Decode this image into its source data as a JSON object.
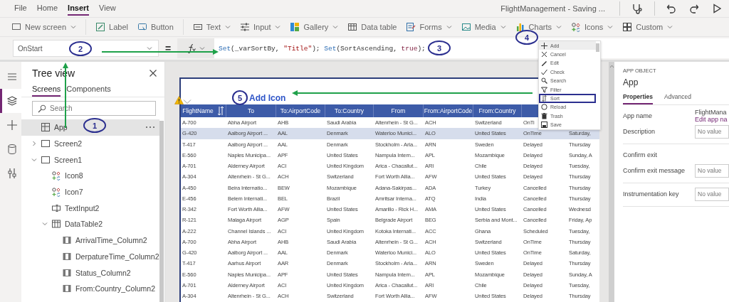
{
  "menu_tabs": [
    {
      "label": "File",
      "selected": false
    },
    {
      "label": "Home",
      "selected": false
    },
    {
      "label": "Insert",
      "selected": true
    },
    {
      "label": "View",
      "selected": false
    }
  ],
  "document_title": "FlightManagement - Saving ...",
  "toolbar": [
    {
      "label": "New screen",
      "dropdown": true
    },
    {
      "label": "Label",
      "dropdown": false
    },
    {
      "label": "Button",
      "dropdown": false
    },
    {
      "label": "Text",
      "dropdown": true
    },
    {
      "label": "Input",
      "dropdown": true
    },
    {
      "label": "Gallery",
      "dropdown": true
    },
    {
      "label": "Data table",
      "dropdown": false
    },
    {
      "label": "Forms",
      "dropdown": true
    },
    {
      "label": "Media",
      "dropdown": true
    },
    {
      "label": "Charts",
      "dropdown": true
    },
    {
      "label": "Icons",
      "dropdown": true
    },
    {
      "label": "Custom",
      "dropdown": true
    }
  ],
  "formula_bar": {
    "property": "OnStart",
    "equals": "=",
    "formula": [
      {
        "text": "Set",
        "kind": "function"
      },
      {
        "text": "(_varSortBy, ",
        "kind": "plain"
      },
      {
        "text": "\"Title\"",
        "kind": "string"
      },
      {
        "text": "); ",
        "kind": "plain"
      },
      {
        "text": "Set",
        "kind": "function"
      },
      {
        "text": "(SortAscending, ",
        "kind": "plain"
      },
      {
        "text": "true",
        "kind": "keyword"
      },
      {
        "text": ");",
        "kind": "plain"
      }
    ]
  },
  "rail": [
    {
      "selected": false
    },
    {
      "selected": true
    },
    {
      "selected": false
    },
    {
      "selected": false
    },
    {
      "selected": false
    }
  ],
  "tree_view": {
    "title": "Tree view",
    "tabs": [
      {
        "label": "Screens",
        "selected": true
      },
      {
        "label": "Components",
        "selected": false
      }
    ],
    "search": {
      "placeholder": "Search"
    },
    "items": [
      {
        "label": "App",
        "kind": "app",
        "selected": true
      },
      {
        "label": "Screen2",
        "kind": "screen",
        "selected": false,
        "expanded": false
      },
      {
        "label": "Screen1",
        "kind": "screen",
        "selected": false,
        "expanded": true,
        "children": [
          {
            "label": "Icon8",
            "kind": "icon",
            "selected": false
          },
          {
            "label": "Icon7",
            "kind": "icon",
            "selected": false
          },
          {
            "label": "TextInput2",
            "kind": "text_input",
            "selected": false
          },
          {
            "label": "DataTable2",
            "kind": "data_table",
            "selected": false,
            "expanded": true,
            "children": [
              {
                "label": "ArrivalTime_Column2",
                "kind": "column",
                "selected": false
              },
              {
                "label": "DerpatureTime_Column2",
                "kind": "column",
                "selected": false
              },
              {
                "label": "Status_Column2",
                "kind": "column",
                "selected": false
              },
              {
                "label": "From:Country_Column2",
                "kind": "column",
                "selected": false
              }
            ]
          }
        ]
      }
    ]
  },
  "table": {
    "columns": [
      {
        "label": "FlightName",
        "sort_icon": true
      },
      {
        "label": "To",
        "sort_icon": false
      },
      {
        "label": "To:AirportCode",
        "sort_icon": false
      },
      {
        "label": "To:Country",
        "sort_icon": false
      },
      {
        "label": "From",
        "sort_icon": false
      },
      {
        "label": "From:AirportCode",
        "sort_icon": false
      },
      {
        "label": "From:Country",
        "sort_icon": false
      }
    ],
    "rows": [
      {
        "selected": false,
        "cells": [
          "A-700",
          "Abha Airport",
          "AHB",
          "Saudi Arabia",
          "Altenrhein - St G...",
          "ACH",
          "Switzerland",
          "OnTi"
        ]
      },
      {
        "selected": true,
        "cells": [
          "G-420",
          "Aalborg Airport ...",
          "AAL",
          "Denmark",
          "Waterloo Munici...",
          "ALO",
          "United States",
          "OnTime",
          "Saturday,"
        ]
      },
      {
        "selected": false,
        "cells": [
          "T-417",
          "Aalborg Airport ...",
          "AAL",
          "Denmark",
          "Stockholm - Arla...",
          "ARN",
          "Sweden",
          "Delayed",
          "Thursday"
        ]
      },
      {
        "selected": false,
        "cells": [
          "E-560",
          "Naples Municipa...",
          "APF",
          "United States",
          "Nampula Intern...",
          "APL",
          "Mozambique",
          "Delayed",
          "Sunday, A"
        ]
      },
      {
        "selected": false,
        "cells": [
          "A-701",
          "Alderney Airport",
          "ACI",
          "United Kingdom",
          "Arica - Chacallut...",
          "ARI",
          "Chile",
          "Delayed",
          "Tuesday,"
        ]
      },
      {
        "selected": false,
        "cells": [
          "A-304",
          "Altenrhein - St G...",
          "ACH",
          "Switzerland",
          "Fort Worth Allia...",
          "AFW",
          "United States",
          "Delayed",
          "Thursday"
        ]
      },
      {
        "selected": false,
        "cells": [
          "A-450",
          "Beira Internatio...",
          "BEW",
          "Mozambique",
          "Adana-Sakirpas...",
          "ADA",
          "Turkey",
          "Cancelled",
          "Thursday"
        ]
      },
      {
        "selected": false,
        "cells": [
          "E-456",
          "Belem Internati...",
          "BEL",
          "Brazil",
          "Amritsar Interna...",
          "ATQ",
          "India",
          "Cancelled",
          "Thursday"
        ]
      },
      {
        "selected": false,
        "cells": [
          "R-342",
          "Fort Worth Allia...",
          "AFW",
          "United States",
          "Amarillo - Rick H...",
          "AMA",
          "United States",
          "Cancelled",
          "Wednesd"
        ]
      },
      {
        "selected": false,
        "cells": [
          "R-121",
          "Malaga Airport",
          "AGP",
          "Spain",
          "Belgrade Airport",
          "BEG",
          "Serbia and Mont...",
          "Cancelled",
          "Friday, Ap"
        ]
      },
      {
        "selected": false,
        "cells": [
          "A-222",
          "Channel Islands ...",
          "ACI",
          "United Kingdom",
          "Kotoka Internati...",
          "ACC",
          "Ghana",
          "Scheduled",
          "Tuesday,"
        ]
      },
      {
        "selected": false,
        "cells": [
          "A-700",
          "Abha Airport",
          "AHB",
          "Saudi Arabia",
          "Altenrhein - St G...",
          "ACH",
          "Switzerland",
          "OnTime",
          "Thursday"
        ]
      },
      {
        "selected": false,
        "cells": [
          "G-420",
          "Aalborg Airport ...",
          "AAL",
          "Denmark",
          "Waterloo Munici...",
          "ALO",
          "United States",
          "OnTime",
          "Saturday,"
        ]
      },
      {
        "selected": false,
        "cells": [
          "T-417",
          "Aarhus Airport",
          "AAR",
          "Denmark",
          "Stockholm - Arla...",
          "ARN",
          "Sweden",
          "Delayed",
          "Thursday"
        ]
      },
      {
        "selected": false,
        "cells": [
          "E-560",
          "Naples Municipa...",
          "APF",
          "United States",
          "Nampula Intern...",
          "APL",
          "Mozambique",
          "Delayed",
          "Sunday, A"
        ]
      },
      {
        "selected": false,
        "cells": [
          "A-701",
          "Alderney Airport",
          "ACI",
          "United Kingdom",
          "Arica - Chacallut...",
          "ARI",
          "Chile",
          "Delayed",
          "Tuesday,"
        ]
      },
      {
        "selected": false,
        "cells": [
          "A-304",
          "Altenrhein - St G...",
          "ACH",
          "Switzerland",
          "Fort Worth Allia...",
          "AFW",
          "United States",
          "Delayed",
          "Thursday"
        ]
      }
    ]
  },
  "icons_menu": {
    "items": [
      {
        "label": "Add",
        "selected": true,
        "outlined": false
      },
      {
        "label": "Cancel",
        "selected": false,
        "outlined": false
      },
      {
        "label": "Edit",
        "selected": false,
        "outlined": false
      },
      {
        "label": "Check",
        "selected": false,
        "outlined": false
      },
      {
        "label": "Search",
        "selected": false,
        "outlined": false
      },
      {
        "label": "Filter",
        "selected": false,
        "outlined": false
      },
      {
        "label": "Sort",
        "selected": false,
        "outlined": true
      },
      {
        "label": "Reload",
        "selected": false,
        "outlined": false
      },
      {
        "label": "Trash",
        "selected": false,
        "outlined": false
      },
      {
        "label": "Save",
        "selected": false,
        "outlined": false
      }
    ]
  },
  "properties_panel": {
    "heading": "APP OBJECT",
    "object": "App",
    "tabs": [
      {
        "label": "Properties",
        "selected": true
      },
      {
        "label": "Advanced",
        "selected": false
      }
    ],
    "sections": [
      {
        "rows": [
          {
            "label": "App name",
            "kind": "text",
            "value": "FlightMana",
            "link": "Edit app na"
          },
          {
            "label": "Description",
            "kind": "field",
            "placeholder": "No value"
          }
        ]
      },
      {
        "rows": [
          {
            "label": "Confirm exit",
            "kind": "label"
          },
          {
            "label": "Confirm exit message",
            "kind": "field",
            "placeholder": "No value"
          }
        ]
      },
      {
        "rows": [
          {
            "label": "Instrumentation key",
            "kind": "field",
            "placeholder": "No value"
          }
        ]
      }
    ]
  },
  "annotations": [
    {
      "label": "1"
    },
    {
      "label": "2"
    },
    {
      "label": "3"
    },
    {
      "label": "4"
    },
    {
      "label": "5",
      "caption": "Add Icon"
    }
  ]
}
